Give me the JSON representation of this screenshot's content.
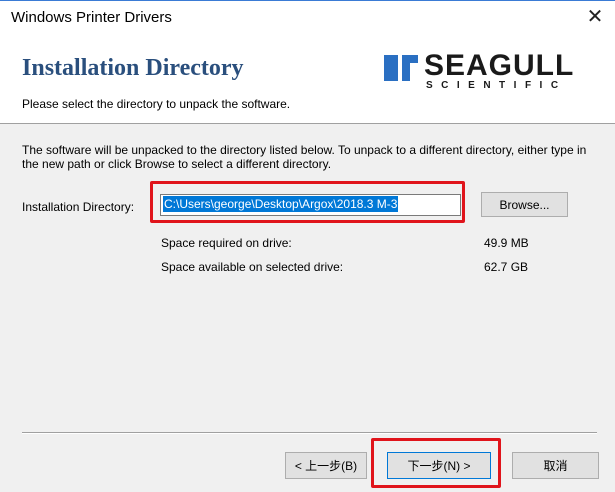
{
  "window": {
    "title": "Windows Printer Drivers",
    "close_glyph": "✕"
  },
  "header": {
    "title": "Installation Directory",
    "subtitle": "Please select the directory to unpack the software.",
    "logo_main": "SEAGULL",
    "logo_sub": "SCIENTIFIC"
  },
  "body": {
    "description": "The software will be unpacked to the directory listed below.  To unpack to a different directory, either type in the new path or click Browse to select a different directory.",
    "dir_label": "Installation Directory:",
    "dir_value": "C:\\Users\\george\\Desktop\\Argox\\2018.3 M-3",
    "browse_label": "Browse...",
    "space_required_label": "Space required on drive:",
    "space_required_value": "49.9 MB",
    "space_available_label": "Space available on selected drive:",
    "space_available_value": "62.7 GB"
  },
  "footer": {
    "back_label": "< 上一步(B)",
    "next_label": "下一步(N) >",
    "cancel_label": "取消"
  },
  "colors": {
    "highlight": "#e0141b",
    "header_title": "#2a4f7d",
    "selection": "#0078d7"
  },
  "icons": {
    "logo_mark": "seagull-logo-icon",
    "close": "close-icon"
  }
}
